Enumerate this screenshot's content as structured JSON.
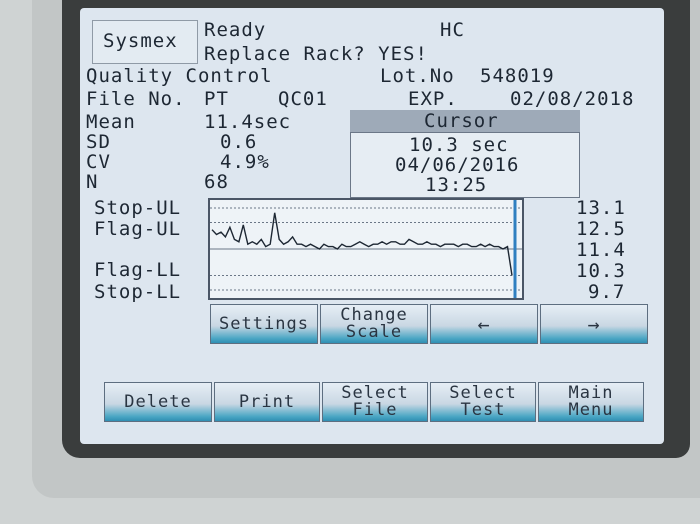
{
  "header": {
    "brand": "Sysmex",
    "status": "Ready",
    "mode": "HC",
    "message": "Replace Rack? YES!"
  },
  "qc": {
    "title": "Quality Control",
    "lot_label": "Lot.No",
    "lot_value": "548019",
    "file_label": "File No.",
    "file_value": "PT",
    "file_code": "QC01",
    "exp_label": "EXP.",
    "exp_value": "02/08/2018"
  },
  "stats": {
    "mean_label": "Mean",
    "mean_value": "11.4sec",
    "sd_label": "SD",
    "sd_value": "0.6",
    "cv_label": "CV",
    "cv_value": "4.9%",
    "n_label": "N",
    "n_value": "68"
  },
  "cursor": {
    "header": "Cursor",
    "value": "10.3 sec",
    "date": "04/06/2016",
    "time": "13:25"
  },
  "limits": {
    "labels": [
      "Stop-UL",
      "Flag-UL",
      "Flag-LL",
      "Stop-LL"
    ],
    "values": [
      "13.1",
      "12.5",
      "11.4",
      "10.3",
      "9.7"
    ]
  },
  "chart_data": {
    "type": "line",
    "y_reference_lines": [
      13.1,
      12.5,
      11.4,
      10.3,
      9.7
    ],
    "ylim": [
      9.7,
      13.1
    ],
    "series": [
      {
        "values": [
          12.2,
          12.0,
          12.1,
          11.9,
          12.3,
          11.8,
          11.7,
          12.4,
          11.6,
          11.7,
          11.6,
          11.8,
          11.5,
          11.6,
          12.9,
          11.8,
          11.6,
          11.7,
          11.9,
          11.6,
          11.6,
          11.5,
          11.6,
          11.5,
          11.4,
          11.6,
          11.5,
          11.5,
          11.4,
          11.6,
          11.5,
          11.5,
          11.6,
          11.7,
          11.6,
          11.5,
          11.6,
          11.6,
          11.7,
          11.6,
          11.7,
          11.7,
          11.6,
          11.6,
          11.8,
          11.7,
          11.6,
          11.6,
          11.7,
          11.6,
          11.6,
          11.5,
          11.6,
          11.6,
          11.6,
          11.5,
          11.6,
          11.6,
          11.5,
          11.5,
          11.6,
          11.5,
          11.6,
          11.5,
          11.5,
          11.4,
          11.5,
          10.3
        ]
      }
    ]
  },
  "buttons": {
    "settings": "Settings",
    "change_scale_1": "Change",
    "change_scale_2": "Scale",
    "left": "←",
    "right": "→",
    "delete": "Delete",
    "print": "Print",
    "select_file_1": "Select",
    "select_file_2": "File",
    "select_test_1": "Select",
    "select_test_2": "Test",
    "main_menu_1": "Main",
    "main_menu_2": "Menu"
  }
}
